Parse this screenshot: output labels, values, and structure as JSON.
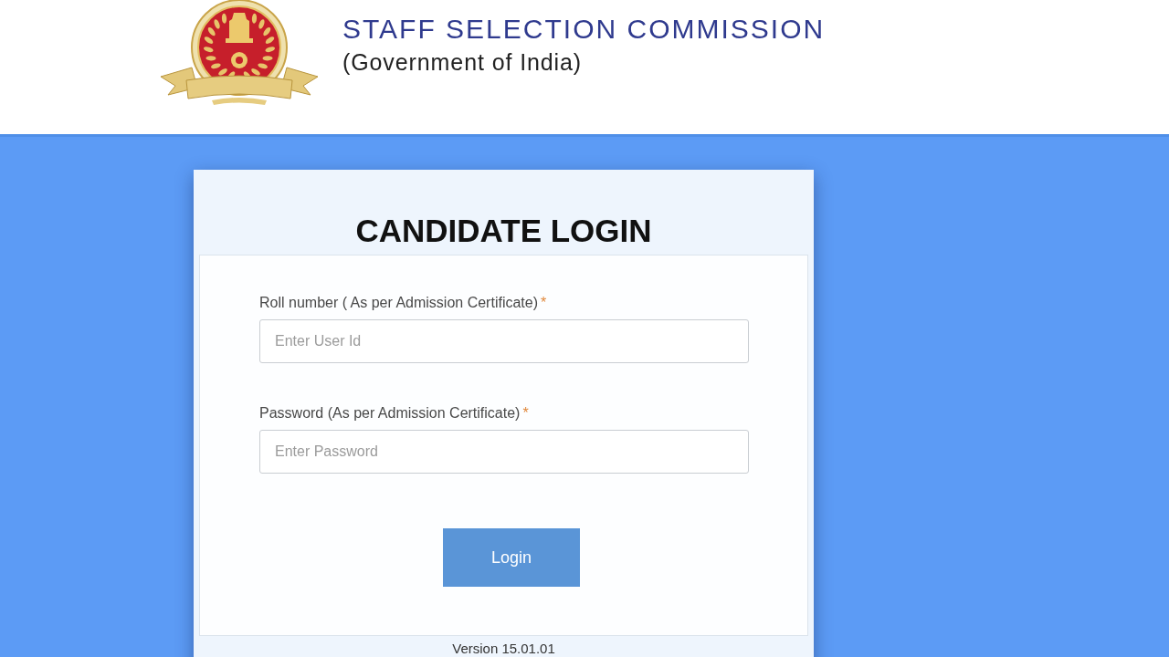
{
  "header": {
    "title": "STAFF SELECTION COMMISSION",
    "subtitle": "(Government of India)"
  },
  "login_card": {
    "title": "CANDIDATE LOGIN",
    "fields": [
      {
        "label": "Roll number ( As per Admission Certificate)",
        "required_mark": "*",
        "placeholder": "Enter User Id"
      },
      {
        "label": "Password (As per Admission Certificate)",
        "required_mark": "*",
        "placeholder": "Enter Password"
      }
    ],
    "login_button": "Login",
    "version": "Version 15.01.01"
  }
}
